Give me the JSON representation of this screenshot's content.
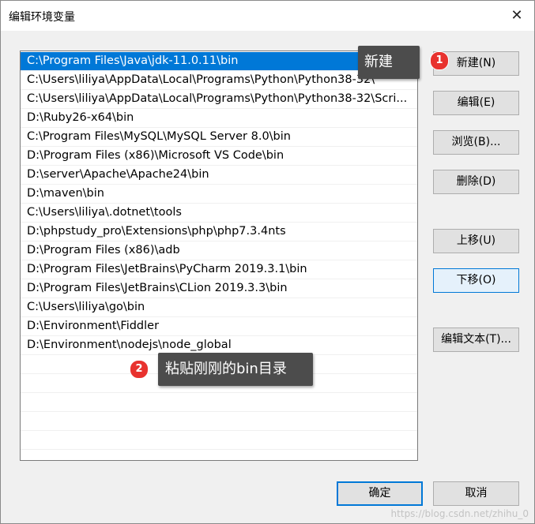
{
  "window": {
    "title": "编辑环境变量",
    "close_glyph": "✕"
  },
  "paths": [
    "C:\\Program Files\\Java\\jdk-11.0.11\\bin",
    "C:\\Users\\liliya\\AppData\\Local\\Programs\\Python\\Python38-32\\",
    "C:\\Users\\liliya\\AppData\\Local\\Programs\\Python\\Python38-32\\Scri...",
    "D:\\Ruby26-x64\\bin",
    "C:\\Program Files\\MySQL\\MySQL Server 8.0\\bin",
    "D:\\Program Files (x86)\\Microsoft VS Code\\bin",
    "D:\\server\\Apache\\Apache24\\bin",
    "D:\\maven\\bin",
    "C:\\Users\\liliya\\.dotnet\\tools",
    "D:\\phpstudy_pro\\Extensions\\php\\php7.3.4nts",
    "D:\\Program Files (x86)\\adb",
    "D:\\Program Files\\JetBrains\\PyCharm 2019.3.1\\bin",
    "D:\\Program Files\\JetBrains\\CLion 2019.3.3\\bin",
    "C:\\Users\\liliya\\go\\bin",
    "D:\\Environment\\Fiddler",
    "D:\\Environment\\nodejs\\node_global"
  ],
  "selected_index": 0,
  "buttons": {
    "new": "新建(N)",
    "edit": "编辑(E)",
    "browse": "浏览(B)...",
    "delete": "删除(D)",
    "move_up": "上移(U)",
    "move_down": "下移(O)",
    "edit_text": "编辑文本(T)...",
    "ok": "确定",
    "cancel": "取消"
  },
  "annotations": {
    "step1_badge": "1",
    "step1_text": "新建",
    "step2_badge": "2",
    "step2_text": "粘贴刚刚的bin目录"
  },
  "watermark": "https://blog.csdn.net/zhihu_0",
  "colors": {
    "selection": "#0078d7",
    "badge": "#e8322e",
    "tooltip": "#4c4c4c"
  }
}
